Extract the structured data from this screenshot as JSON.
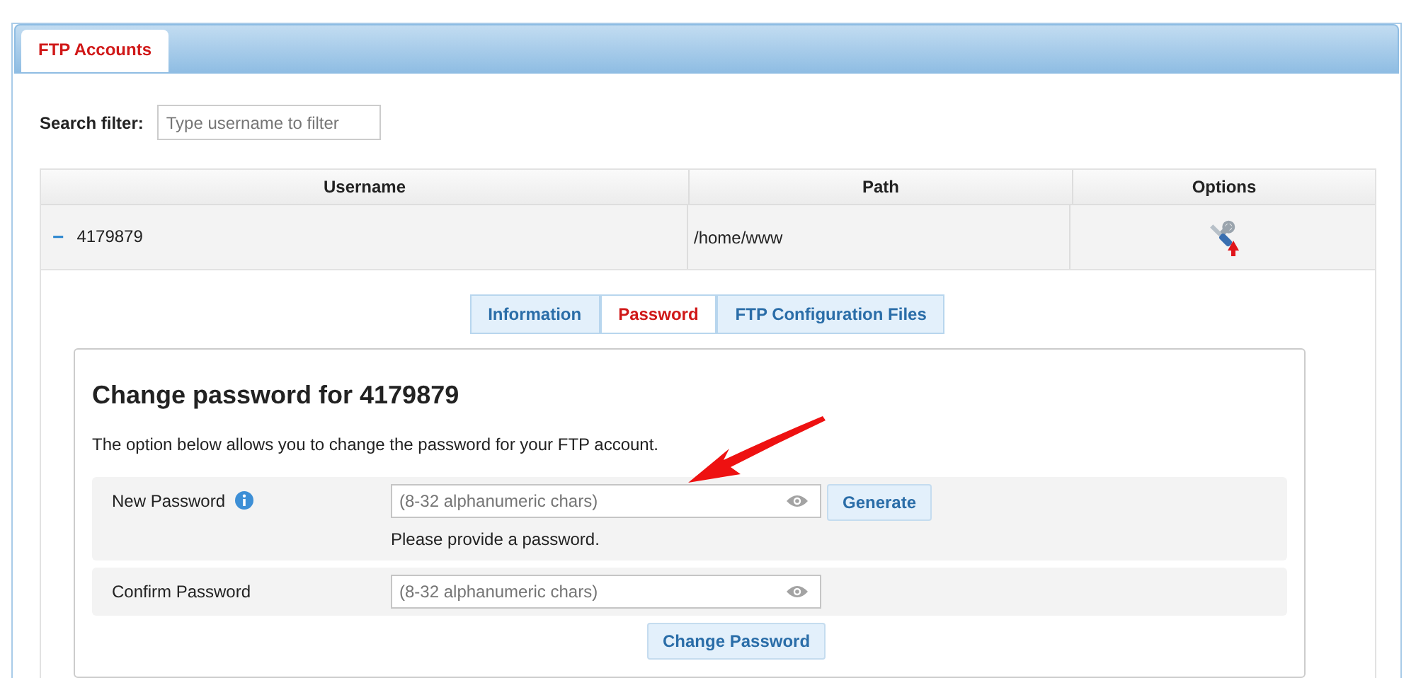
{
  "tabs": [
    {
      "label": "FTP Accounts",
      "selected": true
    }
  ],
  "search": {
    "label": "Search filter:",
    "placeholder": "Type username to filter"
  },
  "table": {
    "columns": [
      "Username",
      "Path",
      "Options"
    ],
    "rows": [
      {
        "expanded": true,
        "toggle": "−",
        "username": "4179879",
        "path": "/home/www"
      }
    ]
  },
  "detail_tabs": [
    {
      "label": "Information",
      "selected": false
    },
    {
      "label": "Password",
      "selected": true
    },
    {
      "label": "FTP Configuration Files",
      "selected": false
    }
  ],
  "panel": {
    "title": "Change password for 4179879",
    "description": "The option below allows you to change the password for your FTP account.",
    "fields": [
      {
        "label": "New Password",
        "info": true,
        "placeholder": "(8-32 alphanumeric chars)",
        "button": "Generate",
        "error": "Please provide a password."
      },
      {
        "label": "Confirm Password",
        "info": false,
        "placeholder": "(8-32 alphanumeric chars)"
      }
    ],
    "submit": "Change Password"
  }
}
